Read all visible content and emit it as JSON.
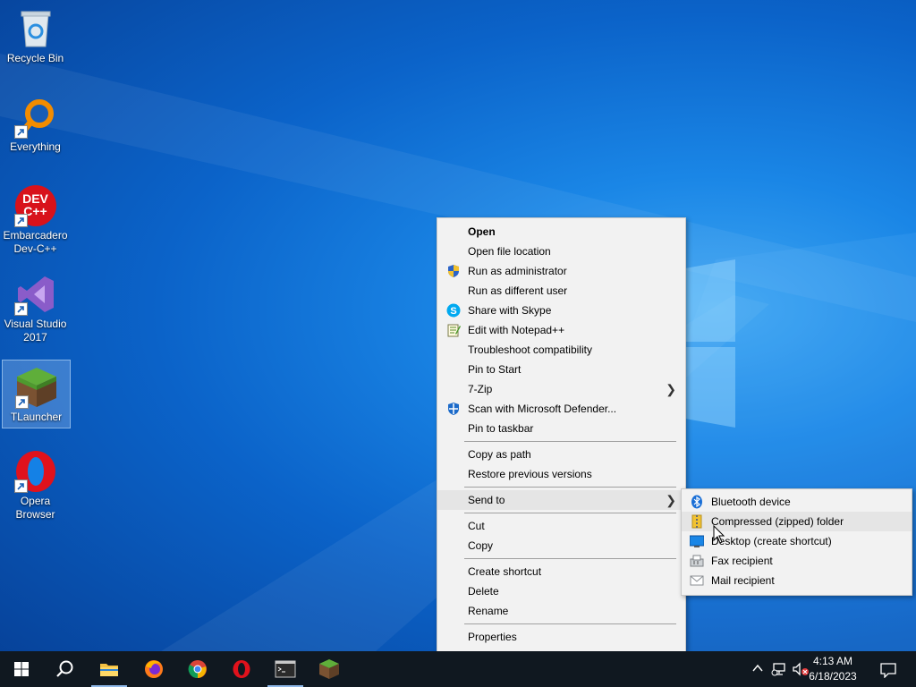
{
  "desktop": {
    "icons": [
      {
        "label": "Recycle Bin"
      },
      {
        "label": "Everything"
      },
      {
        "label": "Embarcadero Dev-C++"
      },
      {
        "label": "Visual Studio 2017"
      },
      {
        "label": "TLauncher"
      },
      {
        "label": "Opera Browser"
      }
    ],
    "devcpp_logo_text": "DEV C++"
  },
  "context_menu": {
    "items": [
      {
        "label": "Open"
      },
      {
        "label": "Open file location"
      },
      {
        "label": "Run as administrator"
      },
      {
        "label": "Run as different user"
      },
      {
        "label": "Share with Skype"
      },
      {
        "label": "Edit with Notepad++"
      },
      {
        "label": "Troubleshoot compatibility"
      },
      {
        "label": "Pin to Start"
      },
      {
        "label": "7-Zip"
      },
      {
        "label": "Scan with Microsoft Defender..."
      },
      {
        "label": "Pin to taskbar"
      },
      {
        "label": "Copy as path"
      },
      {
        "label": "Restore previous versions"
      },
      {
        "label": "Send to"
      },
      {
        "label": "Cut"
      },
      {
        "label": "Copy"
      },
      {
        "label": "Create shortcut"
      },
      {
        "label": "Delete"
      },
      {
        "label": "Rename"
      },
      {
        "label": "Properties"
      }
    ]
  },
  "send_to_menu": {
    "items": [
      {
        "label": "Bluetooth device"
      },
      {
        "label": "Compressed (zipped) folder"
      },
      {
        "label": "Desktop (create shortcut)"
      },
      {
        "label": "Fax recipient"
      },
      {
        "label": "Mail recipient"
      }
    ]
  },
  "taskbar": {
    "time": "4:13 AM",
    "date": "6/18/2023"
  },
  "colors": {
    "accent": "#0a78d7",
    "taskbar": "#101820",
    "menu_bg": "#f2f2f2"
  }
}
